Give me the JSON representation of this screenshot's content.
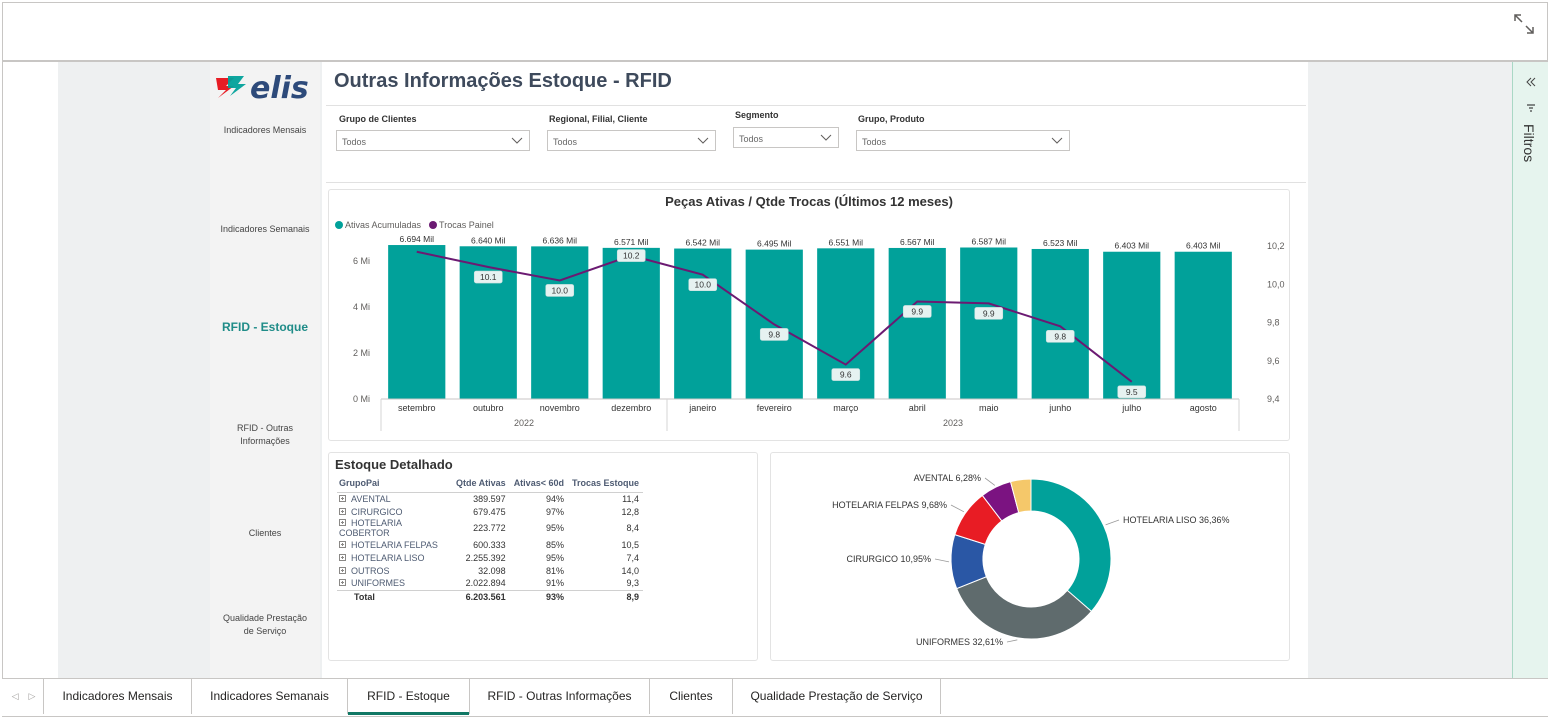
{
  "title": "Outras Informações Estoque - RFID",
  "logo_text": "elis",
  "nav": [
    "Indicadores Mensais",
    "Indicadores Semanais",
    "RFID - Estoque",
    "RFID - Outras Informações",
    "Clientes",
    "Qualidade Prestação de Serviço"
  ],
  "slicers": [
    {
      "label": "Grupo de Clientes",
      "value": "Todos"
    },
    {
      "label": "Regional, Filial, Cliente",
      "value": "Todos"
    },
    {
      "label": "Segmento",
      "value": "Todos"
    },
    {
      "label": "Grupo, Produto",
      "value": "Todos"
    }
  ],
  "filters_pane": {
    "label": "Filtros"
  },
  "tabs": [
    "Indicadores Mensais",
    "Indicadores Semanais",
    "RFID - Estoque",
    "RFID - Outras Informações",
    "Clientes",
    "Qualidade Prestação de Serviço"
  ],
  "active_tab": 2,
  "colors": {
    "accent": "#01a19a",
    "line": "#6b1a72",
    "active_nav": "#1f8c88"
  },
  "chart_data": [
    {
      "type": "bar",
      "title": "Peças Ativas / Qtde Trocas (Últimos 12 meses)",
      "legend": [
        "Ativas Acumuladas",
        "Trocas Painel"
      ],
      "categories": [
        "setembro",
        "outubro",
        "novembro",
        "dezembro",
        "janeiro",
        "fevereiro",
        "março",
        "abril",
        "maio",
        "junho",
        "julho",
        "agosto"
      ],
      "year_groups": [
        {
          "label": "2022",
          "span": 4
        },
        {
          "label": "2023",
          "span": 8
        }
      ],
      "y_ticks_left": [
        "0 Mi",
        "2 Mi",
        "4 Mi",
        "6 Mi"
      ],
      "y_ticks_right": [
        "9,4",
        "9,6",
        "9,8",
        "10,0",
        "10,2"
      ],
      "ylim_left": [
        0,
        7
      ],
      "ylim_right": [
        9.4,
        10.2
      ],
      "series": [
        {
          "name": "Ativas Acumuladas",
          "type": "bar",
          "values": [
            6.694,
            6.64,
            6.636,
            6.571,
            6.542,
            6.495,
            6.551,
            6.567,
            6.587,
            6.523,
            6.403,
            6.403
          ],
          "labels": [
            "6.694 Mil",
            "6.640 Mil",
            "6.636 Mil",
            "6.571 Mil",
            "6.542 Mil",
            "6.495 Mil",
            "6.551 Mil",
            "6.567 Mil",
            "6.587 Mil",
            "6.523 Mil",
            "6.403 Mil",
            "6.403 Mil"
          ]
        },
        {
          "name": "Trocas Painel",
          "type": "line",
          "values": [
            10.2,
            10.1,
            10.0,
            10.2,
            10.0,
            9.8,
            9.6,
            9.9,
            9.9,
            9.8,
            9.5,
            null
          ],
          "plot_values": [
            10.17,
            10.09,
            10.02,
            10.15,
            10.05,
            9.79,
            9.58,
            9.91,
            9.9,
            9.78,
            9.49,
            null
          ],
          "labels": [
            "",
            "10.1",
            "10.0",
            "10.2",
            "10.0",
            "9.8",
            "9.6",
            "9.9",
            "9.9",
            "9.8",
            "9.5",
            ""
          ]
        }
      ]
    },
    {
      "type": "table",
      "title": "Estoque Detalhado",
      "columns": [
        "GrupoPai",
        "Qtde Ativas",
        "Ativas< 60d",
        "Trocas Estoque"
      ],
      "rows": [
        [
          "AVENTAL",
          "389.597",
          "94%",
          "11,4"
        ],
        [
          "CIRURGICO",
          "679.475",
          "97%",
          "12,8"
        ],
        [
          "HOTELARIA COBERTOR",
          "223.772",
          "95%",
          "8,4"
        ],
        [
          "HOTELARIA FELPAS",
          "600.333",
          "85%",
          "10,5"
        ],
        [
          "HOTELARIA LISO",
          "2.255.392",
          "95%",
          "7,4"
        ],
        [
          "OUTROS",
          "32.098",
          "81%",
          "14,0"
        ],
        [
          "UNIFORMES",
          "2.022.894",
          "91%",
          "9,3"
        ]
      ],
      "total": [
        "Total",
        "6.203.561",
        "93%",
        "8,9"
      ]
    },
    {
      "type": "pie",
      "donut": true,
      "slices": [
        {
          "name": "HOTELARIA LISO",
          "value": 36.36,
          "label": "HOTELARIA LISO 36,36%",
          "color": "#01a19a"
        },
        {
          "name": "UNIFORMES",
          "value": 32.61,
          "label": "UNIFORMES 32,61%",
          "color": "#5f6b6d"
        },
        {
          "name": "CIRURGICO",
          "value": 10.95,
          "label": "CIRURGICO 10,95%",
          "color": "#2a57a5"
        },
        {
          "name": "HOTELARIA FELPAS",
          "value": 9.68,
          "label": "HOTELARIA FELPAS 9,68%",
          "color": "#e81c24"
        },
        {
          "name": "AVENTAL",
          "value": 6.28,
          "label": "AVENTAL 6,28%",
          "color": "#7b1381"
        },
        {
          "name": "OUTROS",
          "value": 4.12,
          "label": "",
          "color": "#f5c86a"
        }
      ]
    }
  ]
}
